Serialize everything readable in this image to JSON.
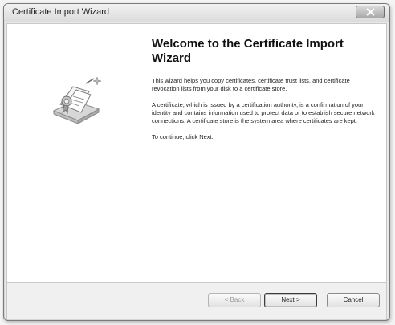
{
  "window": {
    "title": "Certificate Import Wizard"
  },
  "main": {
    "heading": "Welcome to the Certificate Import Wizard",
    "paragraphs": [
      "This wizard helps you copy certificates, certificate trust lists, and certificate revocation lists from your disk to a certificate store.",
      "A certificate, which is issued by a certification authority, is a confirmation of your identity and contains information used to protect data or to establish secure network connections. A certificate store is the system area where certificates are kept.",
      "To continue, click Next."
    ]
  },
  "footer": {
    "back_label": "< Back",
    "next_label": "Next >",
    "cancel_label": "Cancel"
  },
  "icons": {
    "wizard_art": "certificate-wizard-icon",
    "close": "close-icon"
  }
}
